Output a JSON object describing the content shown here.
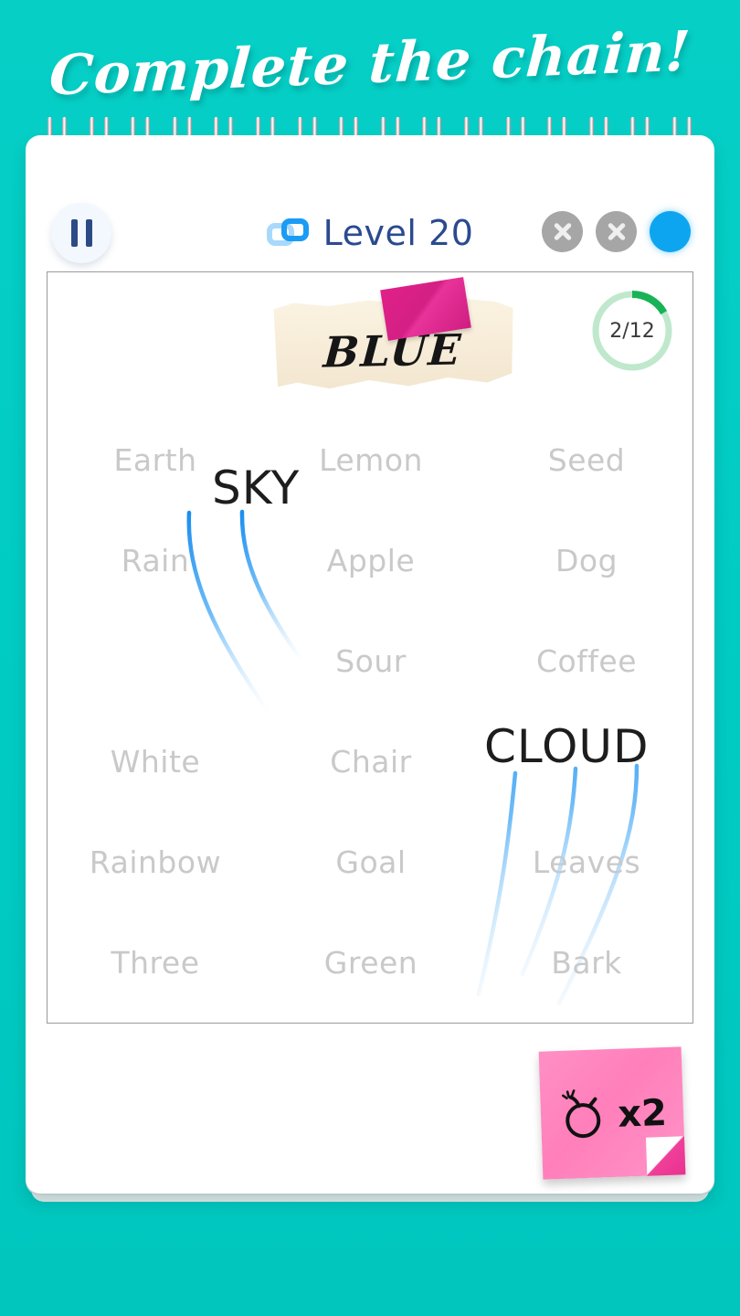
{
  "banner": {
    "title": "Complete the chain!"
  },
  "topbar": {
    "pause_label": "pause",
    "level_label": "Level 20",
    "chain_icon": "chain-links-icon",
    "lives": [
      {
        "state": "used",
        "icon": "x-icon"
      },
      {
        "state": "used",
        "icon": "x-icon"
      },
      {
        "state": "active",
        "icon": "dot-icon"
      }
    ]
  },
  "play": {
    "target_word": "BLUE",
    "tape_color": "#e0218a",
    "progress": {
      "text": "2/12",
      "current": 2,
      "total": 12,
      "color": "#18b356",
      "track_color": "#bfe8cd"
    },
    "grid": [
      [
        "Earth",
        "Lemon",
        "Seed"
      ],
      [
        "Rain",
        "Apple",
        "Dog"
      ],
      [
        "",
        "Sour",
        "Coffee"
      ],
      [
        "White",
        "Chair",
        ""
      ],
      [
        "Rainbow",
        "Goal",
        "Leaves"
      ],
      [
        "Three",
        "Green",
        "Bark"
      ]
    ],
    "active_words": [
      "SKY",
      "CLOUD"
    ]
  },
  "bomb_note": {
    "multiplier": "x2",
    "icon": "bomb-icon",
    "color": "#ff7fbb"
  },
  "colors": {
    "background": "#00ccc4",
    "paper": "#ffffff",
    "accent_blue": "#1a9cf5",
    "level_text": "#2b4a90",
    "word_inactive": "#c9c9c9",
    "word_active": "#1d1d1d"
  }
}
